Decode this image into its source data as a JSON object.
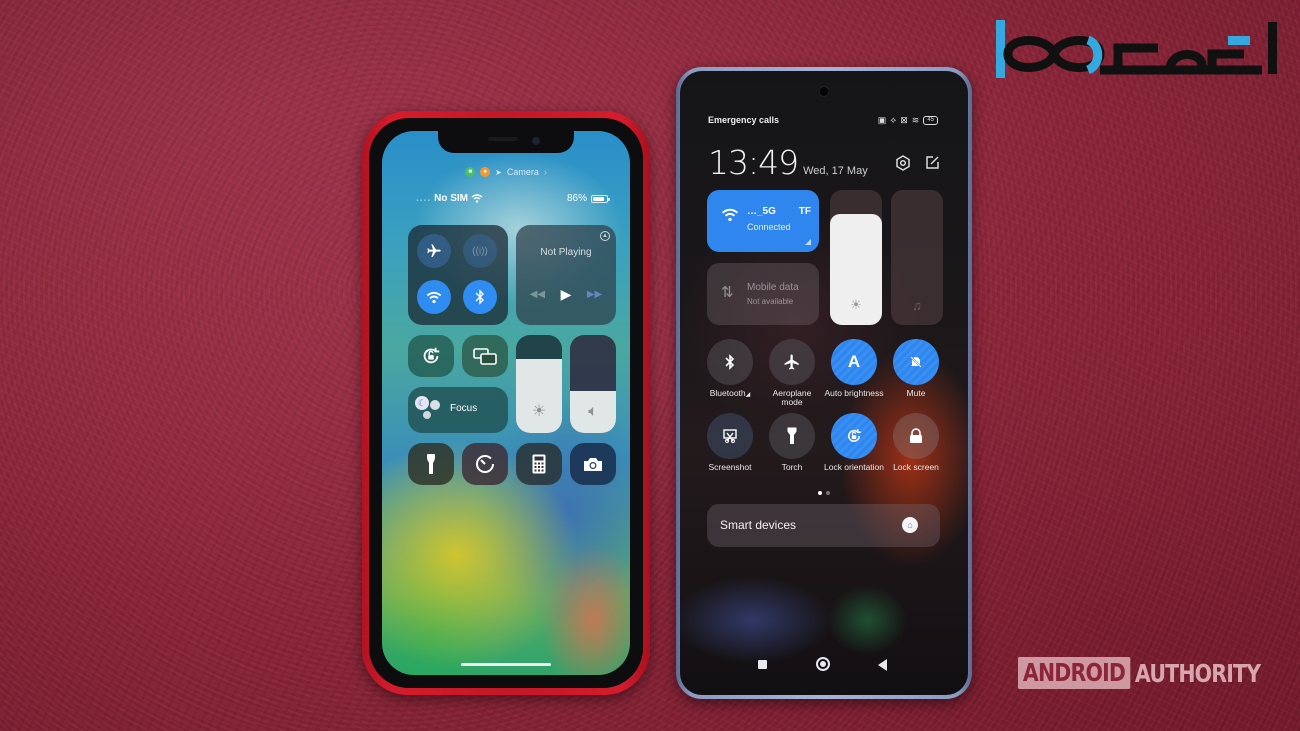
{
  "scene": {
    "description": "Photo of an iPhone (left) and a Xiaomi Android phone (right) showing control centers on red leather",
    "background_color": "#8c2538"
  },
  "logo": {
    "name": "persian-brand-logo",
    "colors": {
      "primary": "#111111",
      "accent": "#35a8e0"
    }
  },
  "watermark": {
    "box_text": "ANDROID",
    "text": "AUTHORITY"
  },
  "iphone": {
    "frame_color": "#c41727",
    "indicators": {
      "camera_icon": "video-camera-icon",
      "mic_icon": "microphone-icon",
      "location_icon": "location-arrow-icon",
      "app_label": "Camera",
      "chevron": "›"
    },
    "status_bar": {
      "carrier": "No SIM",
      "battery_percent": "86%",
      "battery_level": 0.86
    },
    "connectivity": {
      "airplane": {
        "icon": "airplane-icon",
        "active": false
      },
      "cellular": {
        "icon": "cellular-antenna-icon",
        "active": false
      },
      "wifi": {
        "icon": "wifi-icon",
        "active": true
      },
      "bluetooth": {
        "icon": "bluetooth-icon",
        "active": true
      }
    },
    "media": {
      "title": "Not Playing",
      "airplay_icon": "airplay-icon",
      "controls": [
        "rewind-icon",
        "play-icon",
        "fast-forward-icon"
      ]
    },
    "controls": {
      "rotation_lock": {
        "icon": "rotation-lock-icon"
      },
      "screen_mirroring": {
        "icon": "screen-mirroring-icon"
      },
      "focus": {
        "label": "Focus",
        "icon": "moon-icon"
      },
      "brightness_level": 0.76,
      "volume_level": 0.43,
      "flashlight": {
        "icon": "flashlight-icon"
      },
      "timer": {
        "icon": "timer-icon"
      },
      "calculator": {
        "icon": "calculator-icon"
      },
      "camera": {
        "icon": "camera-icon"
      }
    }
  },
  "xiaomi": {
    "frame_color": "#9aa8cc",
    "status_bar": {
      "left_text": "Emergency calls",
      "icons": [
        "nfc-icon",
        "vibrate-off-icon",
        "no-sim-icon",
        "wifi-icon"
      ],
      "battery": "45"
    },
    "clock": {
      "time": "13:49",
      "date": "Wed, 17 May"
    },
    "top_icons": [
      "settings-icon",
      "edit-icon"
    ],
    "wifi_tile": {
      "ssid_start": "…_5G",
      "ssid_end": "TF",
      "status": "Connected",
      "active": true
    },
    "mobile_data_tile": {
      "label": "Mobile data",
      "status": "Not available",
      "active": false
    },
    "brightness_level": 0.82,
    "volume_level": 0.0,
    "toggles": [
      {
        "label": "Bluetooth",
        "suffix": "◢",
        "icon": "bluetooth-icon",
        "active": false
      },
      {
        "label": "Aeroplane mode",
        "icon": "airplane-icon",
        "active": false
      },
      {
        "label": "Auto brightness",
        "icon": "auto-brightness-icon",
        "active": true
      },
      {
        "label": "Mute",
        "icon": "bell-off-icon",
        "active": true
      },
      {
        "label": "Screenshot",
        "icon": "screenshot-icon",
        "active": false
      },
      {
        "label": "Torch",
        "icon": "torch-icon",
        "active": false
      },
      {
        "label": "Lock orientation",
        "icon": "rotation-lock-icon",
        "active": true
      },
      {
        "label": "Lock screen",
        "icon": "lock-icon",
        "active": false
      }
    ],
    "pager": {
      "pages": 2,
      "current": 1
    },
    "smart_devices": {
      "label": "Smart devices",
      "icon": "smart-home-icon"
    },
    "nav": [
      "recents-button",
      "home-button",
      "back-button"
    ]
  }
}
